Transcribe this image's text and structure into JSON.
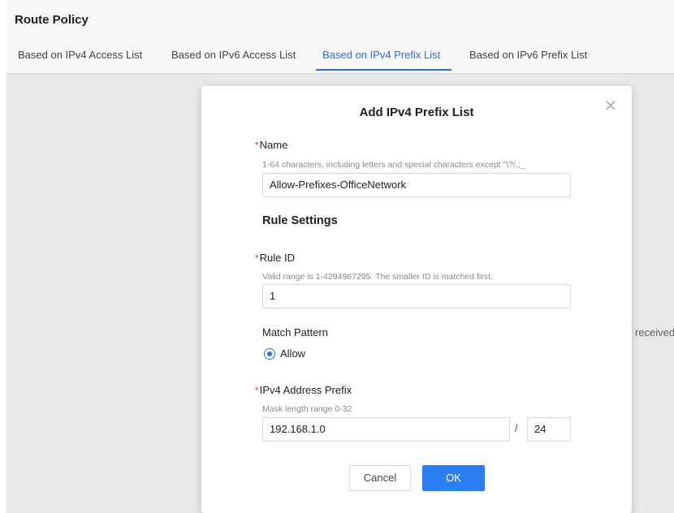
{
  "page": {
    "title": "Route Policy",
    "tabs": [
      {
        "label": "Based on IPv4 Access List",
        "active": false
      },
      {
        "label": "Based on IPv6 Access List",
        "active": false
      },
      {
        "label": "Based on IPv4 Prefix List",
        "active": true
      },
      {
        "label": "Based on IPv6 Prefix List",
        "active": false
      }
    ],
    "background_text": "received"
  },
  "modal": {
    "title": "Add IPv4 Prefix List",
    "required_mark": "*",
    "name": {
      "label": "Name",
      "hint": "1-64 characters, including letters and special characters except \"\\?/,;_",
      "value": "Allow-Prefixes-OfficeNetwork"
    },
    "rule_settings": {
      "title": "Rule Settings",
      "rule_id": {
        "label": "Rule ID",
        "hint": "Valid range is 1-4294967295. The smaller ID is matched first.",
        "value": "1"
      },
      "match_pattern": {
        "label": "Match Pattern",
        "option": "Allow",
        "selected": true
      },
      "prefix": {
        "label": "IPv4 Address Prefix",
        "hint": "Mask length range 0-32",
        "address": "192.168.1.0",
        "separator": "/",
        "mask": "24"
      }
    },
    "buttons": {
      "cancel": "Cancel",
      "ok": "OK"
    }
  },
  "colors": {
    "accent": "#2a6ff3",
    "required": "#e53935"
  }
}
